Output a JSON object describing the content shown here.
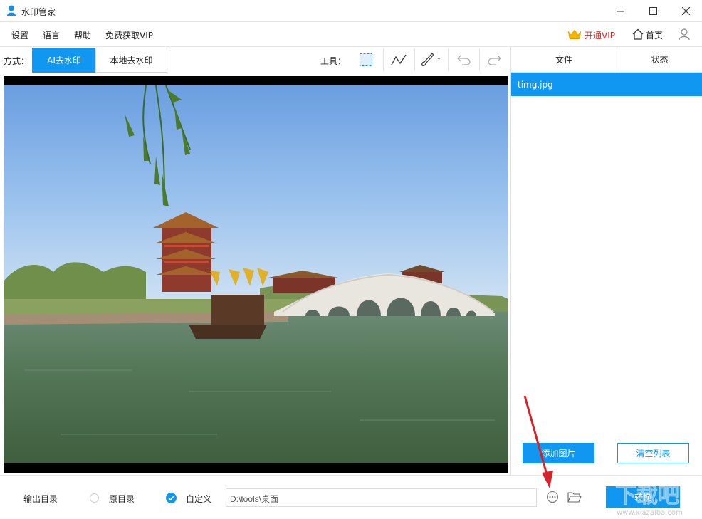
{
  "window": {
    "title": "水印管家"
  },
  "menu": {
    "items": [
      "设置",
      "语言",
      "帮助",
      "免费获取VIP"
    ],
    "vip_label": "开通VIP",
    "home_label": "首页"
  },
  "mode": {
    "label": "方式：",
    "tabs": [
      "AI去水印",
      "本地去水印"
    ],
    "active_tab": "AI去水印"
  },
  "tools": {
    "label": "工具：",
    "icons": [
      "rect-select-icon",
      "polyline-icon",
      "brush-icon",
      "undo-icon",
      "redo-icon"
    ]
  },
  "file_list": {
    "columns": [
      "文件",
      "状态"
    ],
    "files": [
      {
        "name": "timg.jpg",
        "status": "",
        "selected": true
      }
    ],
    "add_label": "添加图片",
    "clear_label": "清空列表"
  },
  "output": {
    "label": "输出目录",
    "options": [
      "原目录",
      "自定义"
    ],
    "selected": "自定义",
    "path": "D:\\tools\\桌面",
    "convert_label": "转换"
  },
  "watermark_overlay": {
    "text": "下载吧",
    "site": "www.xiazaiba.com"
  },
  "colors": {
    "accent": "#0f97f2",
    "vip": "#e2231a",
    "crown": "#f5b400",
    "arrow": "#d8222a"
  }
}
